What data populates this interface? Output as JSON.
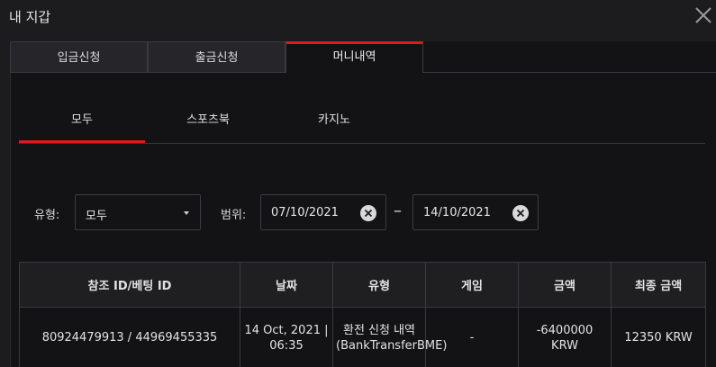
{
  "window": {
    "title": "내 지갑"
  },
  "tabs": [
    {
      "label": "입금신청"
    },
    {
      "label": "출금신청"
    },
    {
      "label": "머니내역"
    }
  ],
  "subtabs": [
    {
      "label": "모두"
    },
    {
      "label": "스포츠북"
    },
    {
      "label": "카지노"
    }
  ],
  "filters": {
    "type_label": "유형:",
    "type_value": "모두",
    "range_label": "범위:",
    "date_from": "07/10/2021",
    "date_separator": "–",
    "date_to": "14/10/2021"
  },
  "table": {
    "headers": [
      "참조 ID/베팅 ID",
      "날짜",
      "유형",
      "게임",
      "금액",
      "최종 금액"
    ],
    "rows": [
      [
        "80924479913 / 44969455335",
        "14 Oct, 2021 | 06:35",
        "환전 신청 내역 (BankTransferBME)",
        "-",
        "-6400000 KRW",
        "12350 KRW"
      ]
    ]
  },
  "colors": {
    "accent": "#e01919",
    "background": "#131315"
  },
  "icons": {
    "close": "close-icon",
    "clear": "clear-icon",
    "caret": "chevron-down-icon"
  }
}
